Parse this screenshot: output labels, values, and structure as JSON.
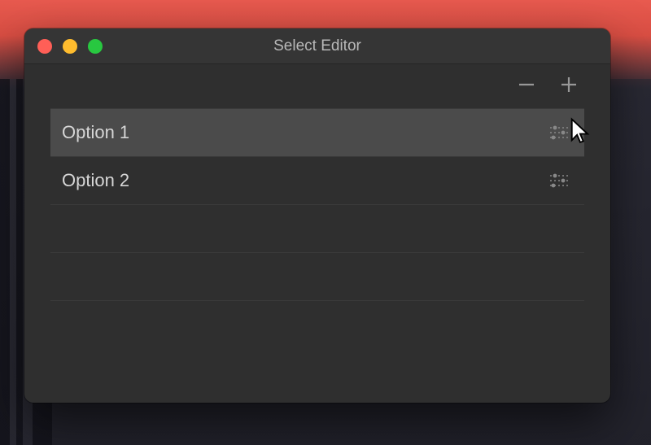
{
  "window": {
    "title": "Select Editor"
  },
  "toolbar": {
    "remove_label": "remove",
    "add_label": "add"
  },
  "options": [
    {
      "label": "Option 1",
      "selected": true,
      "has_content": true
    },
    {
      "label": "Option 2",
      "selected": false,
      "has_content": true
    },
    {
      "label": "",
      "selected": false,
      "has_content": false
    },
    {
      "label": "",
      "selected": false,
      "has_content": false
    }
  ],
  "colors": {
    "window_bg": "#2f2f2f",
    "titlebar_bg": "#353535",
    "selected_row": "#4b4b4b",
    "text": "#d6d6d6",
    "muted": "#989898"
  }
}
